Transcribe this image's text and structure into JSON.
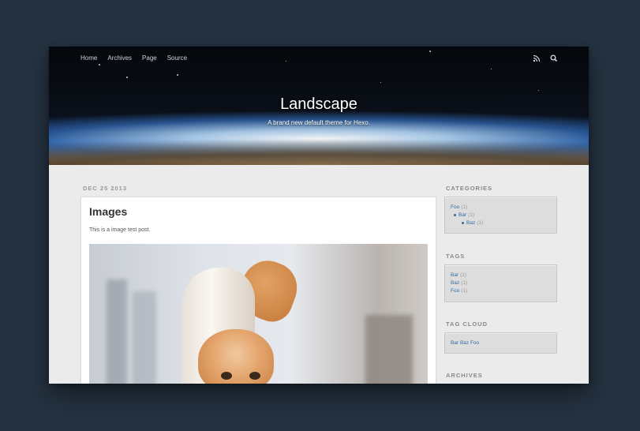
{
  "nav": {
    "items": [
      "Home",
      "Archives",
      "Page",
      "Source"
    ],
    "icons": [
      "rss-icon",
      "search-icon"
    ]
  },
  "site": {
    "title": "Landscape",
    "subtitle": "A brand new default theme for Hexo."
  },
  "post": {
    "date": "DEC 25 2013",
    "title": "Images",
    "body": "This is a image test post."
  },
  "sidebar": {
    "categories": {
      "heading": "CATEGORIES",
      "items": [
        {
          "label": "Foo",
          "count": "(1)"
        },
        {
          "label": "Bar",
          "count": "(1)"
        },
        {
          "label": "Baz",
          "count": "(1)"
        }
      ]
    },
    "tags": {
      "heading": "TAGS",
      "items": [
        {
          "label": "Bar",
          "count": "(1)"
        },
        {
          "label": "Baz",
          "count": "(1)"
        },
        {
          "label": "Foo",
          "count": "(1)"
        }
      ]
    },
    "tag_cloud": {
      "heading": "TAG CLOUD",
      "items": [
        "Bar",
        "Baz",
        "Foo"
      ]
    },
    "archives": {
      "heading": "ARCHIVES"
    }
  },
  "colors": {
    "backdrop": "#253241",
    "link": "#2e6aa8",
    "page_bg": "#ebebeb"
  }
}
